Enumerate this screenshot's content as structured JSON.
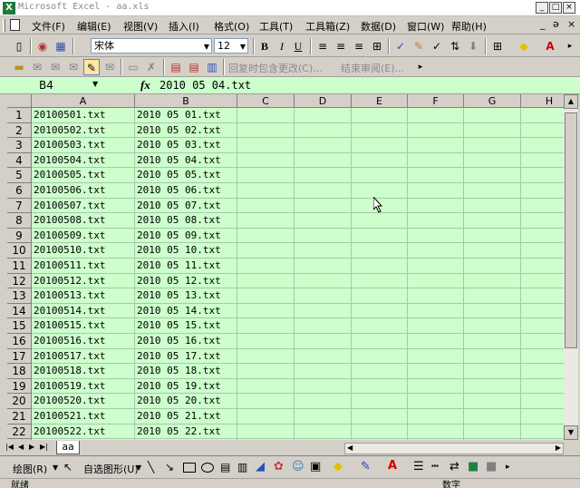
{
  "window": {
    "title": "Microsoft Excel - aa.xls",
    "icon_label": "X"
  },
  "menu": {
    "items": [
      "文件(F)",
      "编辑(E)",
      "视图(V)",
      "插入(I)",
      "格式(O)",
      "工具(T)",
      "工具箱(Z)",
      "数据(D)",
      "窗口(W)",
      "帮助(H)"
    ],
    "right_controls": [
      "_",
      "ə",
      "×"
    ]
  },
  "toolbar": {
    "font_name": "宋体",
    "font_size": "12",
    "bold": "B",
    "italic": "I",
    "underline": "U",
    "review_reply": "回复时包含更改(C)...",
    "review_end": "结束审阅(E)..."
  },
  "formula_bar": {
    "name_box": "B4",
    "fx": "fx",
    "formula": "2010 05 04.txt"
  },
  "columns": [
    "A",
    "B",
    "C",
    "D",
    "E",
    "F",
    "G",
    "H"
  ],
  "rows": [
    {
      "n": "1",
      "a": "20100501.txt",
      "b": "2010 05 01.txt"
    },
    {
      "n": "2",
      "a": "20100502.txt",
      "b": "2010 05 02.txt"
    },
    {
      "n": "3",
      "a": "20100503.txt",
      "b": "2010 05 03.txt"
    },
    {
      "n": "4",
      "a": "20100504.txt",
      "b": "2010 05 04.txt"
    },
    {
      "n": "5",
      "a": "20100505.txt",
      "b": "2010 05 05.txt"
    },
    {
      "n": "6",
      "a": "20100506.txt",
      "b": "2010 05 06.txt"
    },
    {
      "n": "7",
      "a": "20100507.txt",
      "b": "2010 05 07.txt"
    },
    {
      "n": "8",
      "a": "20100508.txt",
      "b": "2010 05 08.txt"
    },
    {
      "n": "9",
      "a": "20100509.txt",
      "b": "2010 05 09.txt"
    },
    {
      "n": "10",
      "a": "20100510.txt",
      "b": "2010 05 10.txt"
    },
    {
      "n": "11",
      "a": "20100511.txt",
      "b": "2010 05 11.txt"
    },
    {
      "n": "12",
      "a": "20100512.txt",
      "b": "2010 05 12.txt"
    },
    {
      "n": "13",
      "a": "20100513.txt",
      "b": "2010 05 13.txt"
    },
    {
      "n": "14",
      "a": "20100514.txt",
      "b": "2010 05 14.txt"
    },
    {
      "n": "15",
      "a": "20100515.txt",
      "b": "2010 05 15.txt"
    },
    {
      "n": "16",
      "a": "20100516.txt",
      "b": "2010 05 16.txt"
    },
    {
      "n": "17",
      "a": "20100517.txt",
      "b": "2010 05 17.txt"
    },
    {
      "n": "18",
      "a": "20100518.txt",
      "b": "2010 05 18.txt"
    },
    {
      "n": "19",
      "a": "20100519.txt",
      "b": "2010 05 19.txt"
    },
    {
      "n": "20",
      "a": "20100520.txt",
      "b": "2010 05 20.txt"
    },
    {
      "n": "21",
      "a": "20100521.txt",
      "b": "2010 05 21.txt"
    },
    {
      "n": "22",
      "a": "20100522.txt",
      "b": "2010 05 22.txt"
    }
  ],
  "sheet_tabs": [
    "aa"
  ],
  "drawing": {
    "draw_label": "绘图(R)",
    "autoshapes_label": "自选图形(U)"
  },
  "status": {
    "left": "就绪",
    "right": "数字"
  },
  "colors": {
    "cell_background": "#ccffcc",
    "chrome": "#d4d0c8"
  }
}
